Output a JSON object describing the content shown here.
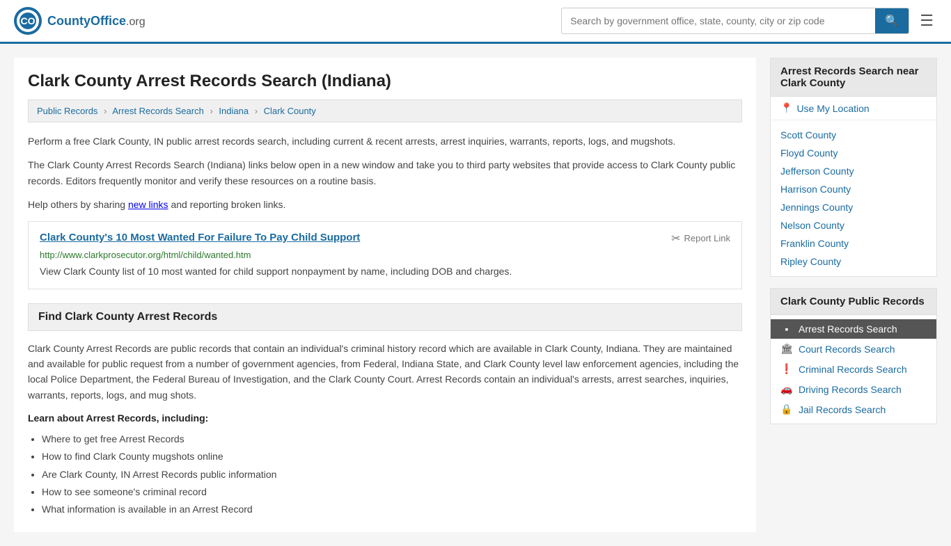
{
  "header": {
    "logo_text": "CountyOffice",
    "logo_suffix": ".org",
    "search_placeholder": "Search by government office, state, county, city or zip code"
  },
  "page": {
    "title": "Clark County Arrest Records Search (Indiana)",
    "breadcrumbs": [
      {
        "label": "Public Records",
        "href": "#"
      },
      {
        "label": "Arrest Records Search",
        "href": "#"
      },
      {
        "label": "Indiana",
        "href": "#"
      },
      {
        "label": "Clark County",
        "href": "#"
      }
    ],
    "description1": "Perform a free Clark County, IN public arrest records search, including current & recent arrests, arrest inquiries, warrants, reports, logs, and mugshots.",
    "description2": "The Clark County Arrest Records Search (Indiana) links below open in a new window and take you to third party websites that provide access to Clark County public records. Editors frequently monitor and verify these resources on a routine basis.",
    "description3_prefix": "Help others by sharing ",
    "description3_link": "new links",
    "description3_suffix": " and reporting broken links."
  },
  "link_card": {
    "title": "Clark County's 10 Most Wanted For Failure To Pay Child Support",
    "url": "http://www.clarkprosecutor.org/html/child/wanted.htm",
    "description": "View Clark County list of 10 most wanted for child support nonpayment by name, including DOB and charges.",
    "report_label": "Report Link"
  },
  "find_section": {
    "header": "Find Clark County Arrest Records",
    "body": "Clark County Arrest Records are public records that contain an individual's criminal history record which are available in Clark County, Indiana. They are maintained and available for public request from a number of government agencies, from Federal, Indiana State, and Clark County level law enforcement agencies, including the local Police Department, the Federal Bureau of Investigation, and the Clark County Court. Arrest Records contain an individual's arrests, arrest searches, inquiries, warrants, reports, logs, and mug shots.",
    "learn_header": "Learn about Arrest Records, including:",
    "learn_items": [
      "Where to get free Arrest Records",
      "How to find Clark County mugshots online",
      "Are Clark County, IN Arrest Records public information",
      "How to see someone's criminal record",
      "What information is available in an Arrest Record"
    ]
  },
  "sidebar": {
    "nearby_title": "Arrest Records Search near Clark County",
    "use_location_label": "Use My Location",
    "nearby_counties": [
      {
        "label": "Scott County",
        "href": "#"
      },
      {
        "label": "Floyd County",
        "href": "#"
      },
      {
        "label": "Jefferson County",
        "href": "#"
      },
      {
        "label": "Harrison County",
        "href": "#"
      },
      {
        "label": "Jennings County",
        "href": "#"
      },
      {
        "label": "Nelson County",
        "href": "#"
      },
      {
        "label": "Franklin County",
        "href": "#"
      },
      {
        "label": "Ripley County",
        "href": "#"
      }
    ],
    "public_records_title": "Clark County Public Records",
    "public_records_items": [
      {
        "label": "Arrest Records Search",
        "icon": "▪",
        "active": true
      },
      {
        "label": "Court Records Search",
        "icon": "🏛"
      },
      {
        "label": "Criminal Records Search",
        "icon": "❗"
      },
      {
        "label": "Driving Records Search",
        "icon": "🚗"
      },
      {
        "label": "Jail Records Search",
        "icon": "🔒"
      }
    ]
  }
}
